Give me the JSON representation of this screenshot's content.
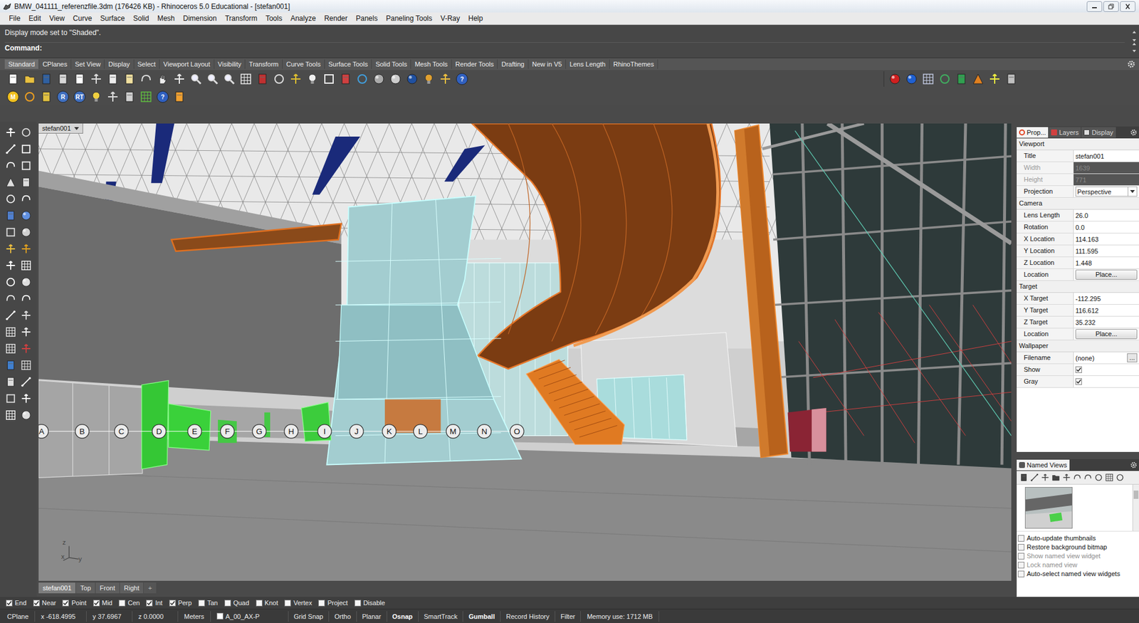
{
  "window": {
    "title": "BMW_041111_referenzfile.3dm (176426 KB) - Rhinoceros 5.0 Educational - [stefan001]"
  },
  "menu": [
    "File",
    "Edit",
    "View",
    "Curve",
    "Surface",
    "Solid",
    "Mesh",
    "Dimension",
    "Transform",
    "Tools",
    "Analyze",
    "Render",
    "Panels",
    "Paneling Tools",
    "V-Ray",
    "Help"
  ],
  "command": {
    "history": "Display mode set to \"Shaded\".",
    "prompt": "Command:"
  },
  "toolbar_tabs": [
    {
      "label": "Standard",
      "selected": true
    },
    {
      "label": "CPlanes",
      "selected": false
    },
    {
      "label": "Set View",
      "selected": false
    },
    {
      "label": "Display",
      "selected": false
    },
    {
      "label": "Select",
      "selected": false
    },
    {
      "label": "Viewport Layout",
      "selected": false
    },
    {
      "label": "Visibility",
      "selected": false
    },
    {
      "label": "Transform",
      "selected": false
    },
    {
      "label": "Curve Tools",
      "selected": false
    },
    {
      "label": "Surface Tools",
      "selected": false
    },
    {
      "label": "Solid Tools",
      "selected": false
    },
    {
      "label": "Mesh Tools",
      "selected": false
    },
    {
      "label": "Render Tools",
      "selected": false
    },
    {
      "label": "Drafting",
      "selected": false
    },
    {
      "label": "New in V5",
      "selected": false
    },
    {
      "label": "Lens Length",
      "selected": false
    },
    {
      "label": "RhinoThemes",
      "selected": false
    }
  ],
  "standard_help": "?",
  "vray_badges": [
    "M",
    "R",
    "RT",
    "?"
  ],
  "viewport": {
    "title": "stefan001",
    "grid_labels": [
      "A",
      "B",
      "C",
      "D",
      "E",
      "F",
      "G",
      "H",
      "I",
      "J",
      "K",
      "L",
      "M",
      "N",
      "O"
    ],
    "axes": [
      "z",
      "x",
      "y"
    ]
  },
  "viewport_tabs": [
    {
      "label": "stefan001",
      "selected": true
    },
    {
      "label": "Top",
      "selected": false
    },
    {
      "label": "Front",
      "selected": false
    },
    {
      "label": "Right",
      "selected": false
    }
  ],
  "new_viewport_tab": "+",
  "panel_tabs": [
    {
      "label": "Prop...",
      "selected": true
    },
    {
      "label": "Layers",
      "selected": false
    },
    {
      "label": "Display",
      "selected": false
    }
  ],
  "properties": [
    {
      "title": "Viewport",
      "rows": [
        {
          "label": "Title",
          "kind": "text",
          "value": "stefan001",
          "disabled": false
        },
        {
          "label": "Width",
          "kind": "text",
          "value": "1639",
          "disabled": true
        },
        {
          "label": "Height",
          "kind": "text",
          "value": "771",
          "disabled": true
        },
        {
          "label": "Projection",
          "kind": "dropdown",
          "value": "Perspective",
          "disabled": false
        }
      ]
    },
    {
      "title": "Camera",
      "rows": [
        {
          "label": "Lens Length",
          "kind": "text",
          "value": "26.0",
          "disabled": false
        },
        {
          "label": "Rotation",
          "kind": "text",
          "value": "0.0",
          "disabled": false
        },
        {
          "label": "X Location",
          "kind": "text",
          "value": "114.163",
          "disabled": false
        },
        {
          "label": "Y Location",
          "kind": "text",
          "value": "111.595",
          "disabled": false
        },
        {
          "label": "Z Location",
          "kind": "text",
          "value": "1.448",
          "disabled": false
        },
        {
          "label": "Location",
          "kind": "button",
          "value": "Place...",
          "disabled": false
        }
      ]
    },
    {
      "title": "Target",
      "rows": [
        {
          "label": "X Target",
          "kind": "text",
          "value": "-112.295",
          "disabled": false
        },
        {
          "label": "Y Target",
          "kind": "text",
          "value": "116.612",
          "disabled": false
        },
        {
          "label": "Z Target",
          "kind": "text",
          "value": "35.232",
          "disabled": false
        },
        {
          "label": "Location",
          "kind": "button",
          "value": "Place...",
          "disabled": false
        }
      ]
    },
    {
      "title": "Wallpaper",
      "rows": [
        {
          "label": "Filename",
          "kind": "file",
          "value": "(none)",
          "button": "...",
          "disabled": false
        },
        {
          "label": "Show",
          "kind": "checkbox",
          "checked": true,
          "disabled": false
        },
        {
          "label": "Gray",
          "kind": "checkbox",
          "checked": true,
          "disabled": false
        }
      ]
    }
  ],
  "named_views": {
    "title": "Named Views",
    "options": [
      {
        "label": "Auto-update thumbnails",
        "checked": false,
        "disabled": false
      },
      {
        "label": "Restore background bitmap",
        "checked": false,
        "disabled": false
      },
      {
        "label": "Show named view widget",
        "checked": false,
        "disabled": true
      },
      {
        "label": "Lock named view",
        "checked": false,
        "disabled": true
      },
      {
        "label": "Auto-select named view widgets",
        "checked": false,
        "disabled": false
      }
    ]
  },
  "osnaps": [
    {
      "label": "End",
      "checked": true
    },
    {
      "label": "Near",
      "checked": true
    },
    {
      "label": "Point",
      "checked": true
    },
    {
      "label": "Mid",
      "checked": true
    },
    {
      "label": "Cen",
      "checked": false
    },
    {
      "label": "Int",
      "checked": true
    },
    {
      "label": "Perp",
      "checked": true
    },
    {
      "label": "Tan",
      "checked": false
    },
    {
      "label": "Quad",
      "checked": false
    },
    {
      "label": "Knot",
      "checked": false
    },
    {
      "label": "Vertex",
      "checked": false
    },
    {
      "label": "Project",
      "checked": false
    },
    {
      "label": "Disable",
      "checked": false
    }
  ],
  "status_bar": [
    {
      "text": "CPlane",
      "kind": "pane",
      "on": false
    },
    {
      "text": "x -618.4995",
      "kind": "pane",
      "on": false
    },
    {
      "text": "y 37.6967",
      "kind": "pane",
      "on": false
    },
    {
      "text": "z 0.0000",
      "kind": "pane",
      "on": false
    },
    {
      "text": "Meters",
      "kind": "pane",
      "on": false
    },
    {
      "text": "A_00_AX-P",
      "kind": "layer",
      "on": false
    },
    {
      "text": "Grid Snap",
      "kind": "toggle",
      "on": false
    },
    {
      "text": "Ortho",
      "kind": "toggle",
      "on": false
    },
    {
      "text": "Planar",
      "kind": "toggle",
      "on": false
    },
    {
      "text": "Osnap",
      "kind": "toggle",
      "on": true
    },
    {
      "text": "SmartTrack",
      "kind": "toggle",
      "on": false
    },
    {
      "text": "Gumball",
      "kind": "toggle",
      "on": true
    },
    {
      "text": "Record History",
      "kind": "toggle",
      "on": false
    },
    {
      "text": "Filter",
      "kind": "toggle",
      "on": false
    },
    {
      "text": "Memory use: 1712 MB",
      "kind": "pane",
      "on": false
    }
  ]
}
